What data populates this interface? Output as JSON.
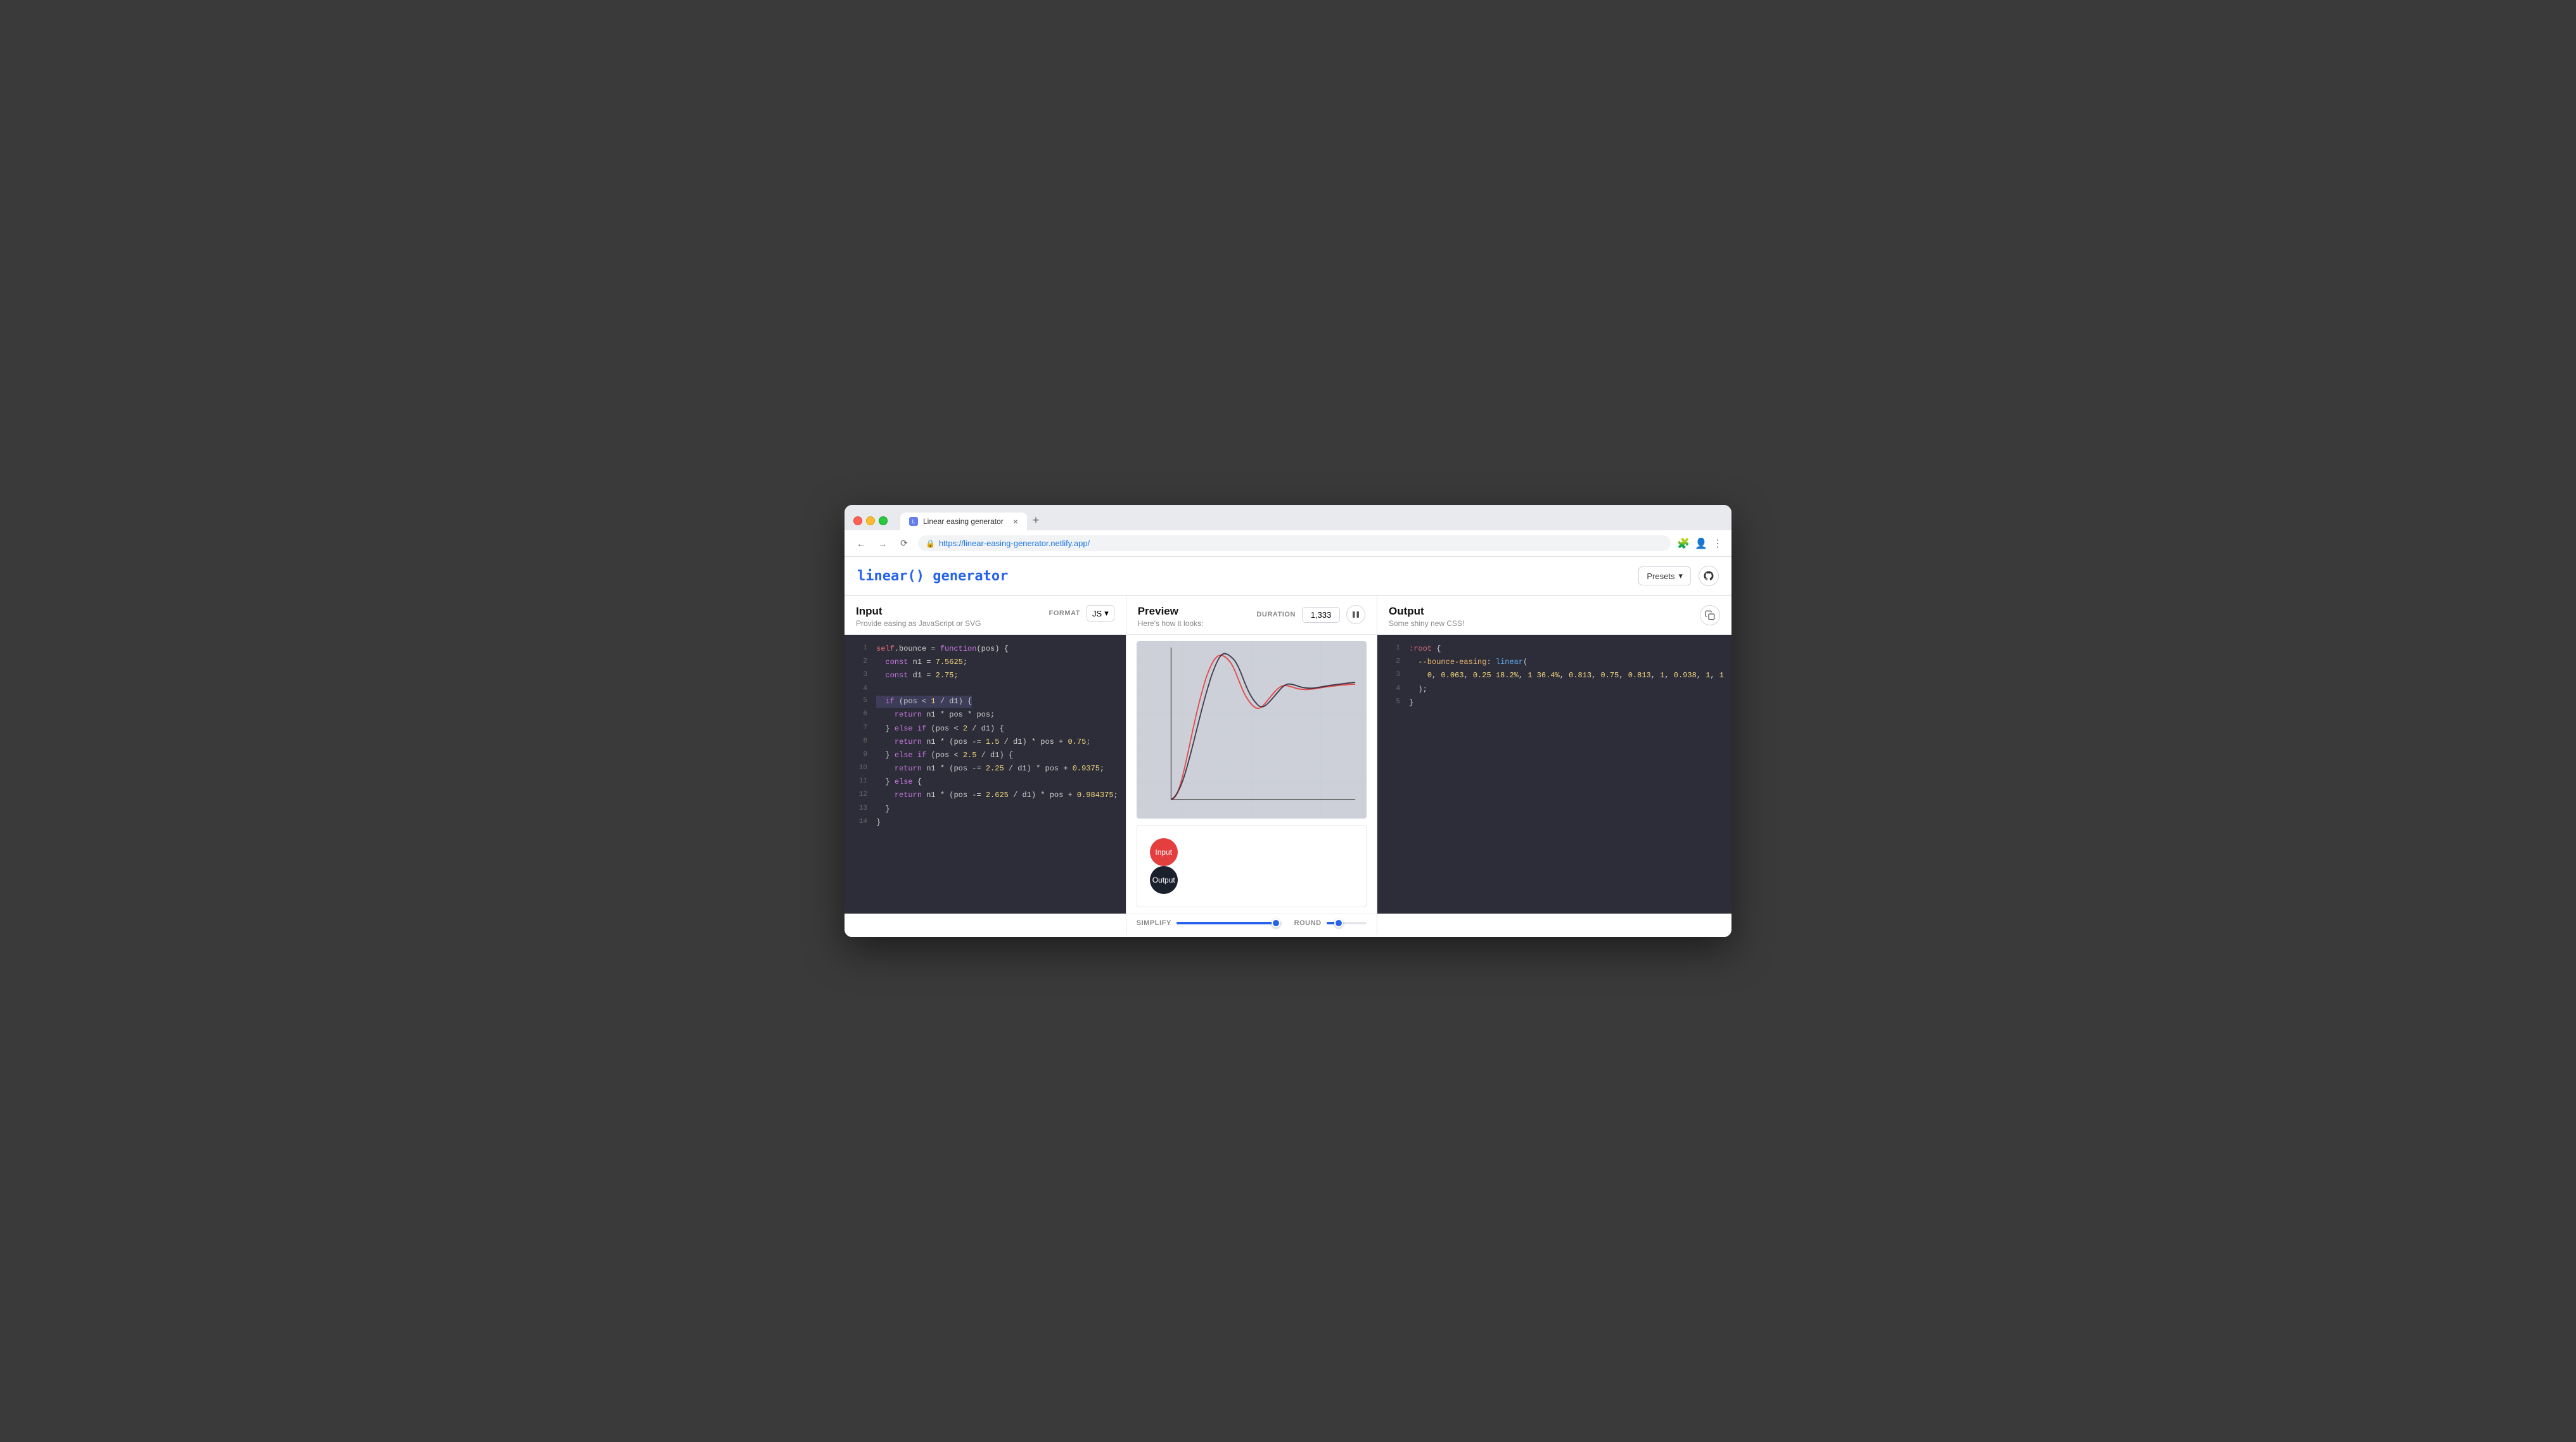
{
  "browser": {
    "tab_title": "Linear easing generator",
    "url": "https://linear-easing-generator.netlify.app/",
    "new_tab_label": "+"
  },
  "app": {
    "logo": "linear() generator",
    "header": {
      "presets_label": "Presets",
      "github_icon": "github-icon"
    }
  },
  "input_panel": {
    "title": "Input",
    "subtitle": "Provide easing as JavaScript or SVG",
    "format_label": "FORMAT",
    "format_value": "JS",
    "code_lines": [
      {
        "num": 1,
        "text": "self.bounce = function(pos) {"
      },
      {
        "num": 2,
        "text": "  const n1 = 7.5625;"
      },
      {
        "num": 3,
        "text": "  const d1 = 2.75;"
      },
      {
        "num": 4,
        "text": ""
      },
      {
        "num": 5,
        "text": "  if (pos < 1 / d1) {"
      },
      {
        "num": 6,
        "text": "    return n1 * pos * pos;"
      },
      {
        "num": 7,
        "text": "  } else if (pos < 2 / d1) {"
      },
      {
        "num": 8,
        "text": "    return n1 * (pos -= 1.5 / d1) * pos + 0.75;"
      },
      {
        "num": 9,
        "text": "  } else if (pos < 2.5 / d1) {"
      },
      {
        "num": 10,
        "text": "    return n1 * (pos -= 2.25 / d1) * pos + 0.9375;"
      },
      {
        "num": 11,
        "text": "  } else {"
      },
      {
        "num": 12,
        "text": "    return n1 * (pos -= 2.625 / d1) * pos + 0.984375;"
      },
      {
        "num": 13,
        "text": "  }"
      },
      {
        "num": 14,
        "text": "}"
      }
    ]
  },
  "preview_panel": {
    "title": "Preview",
    "subtitle": "Here's how it looks:",
    "duration_label": "DURATION",
    "duration_value": "1,333",
    "pause_icon": "pause-icon",
    "input_ball_label": "Input",
    "output_ball_label": "Output"
  },
  "output_panel": {
    "title": "Output",
    "subtitle": "Some shiny new CSS!",
    "copy_icon": "copy-icon",
    "code_lines": [
      {
        "num": 1,
        "text": ":root {"
      },
      {
        "num": 2,
        "text": "  --bounce-easing: linear("
      },
      {
        "num": 3,
        "text": "    0, 0.063, 0.25 18.2%, 1 36.4%, 0.813, 0.75, 0.813, 1, 0.938, 1, 1"
      },
      {
        "num": 4,
        "text": "  );"
      },
      {
        "num": 5,
        "text": "}"
      }
    ]
  },
  "simplify": {
    "label": "SIMPLIFY",
    "fill_percent": 95,
    "thumb_percent": 95
  },
  "round": {
    "label": "ROUND",
    "fill_percent": 30,
    "thumb_percent": 30
  }
}
